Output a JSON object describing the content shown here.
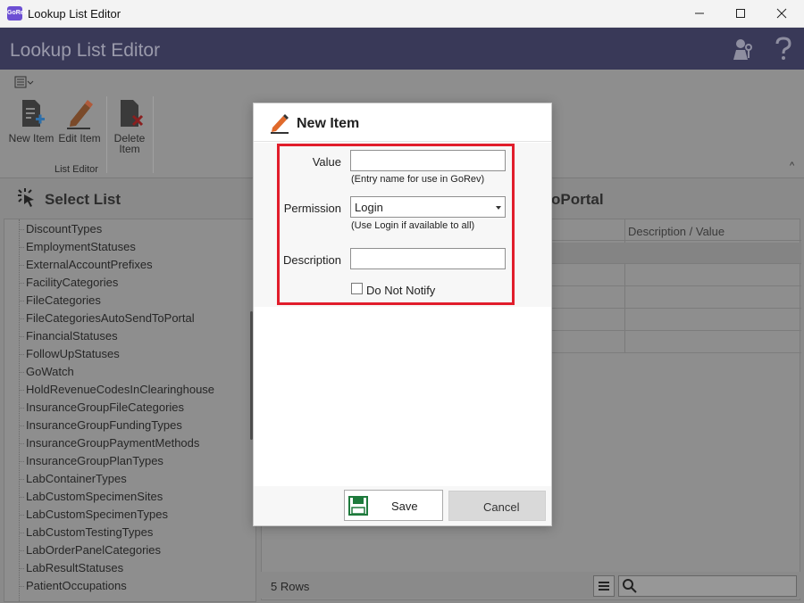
{
  "window": {
    "title": "Lookup List Editor",
    "app_icon_label": "GoRev"
  },
  "header": {
    "title": "Lookup List Editor",
    "icons": [
      "user-keys-icon",
      "help-icon"
    ]
  },
  "ribbon": {
    "buttons": [
      {
        "label": "New Item",
        "icon": "document-plus-icon"
      },
      {
        "label": "Edit Item",
        "icon": "pencil-icon"
      },
      {
        "label": "Delete Item",
        "icon": "document-delete-icon"
      }
    ],
    "group_label": "List Editor"
  },
  "select_list": {
    "title": "Select List",
    "items": [
      "DiscountTypes",
      "EmploymentStatuses",
      "ExternalAccountPrefixes",
      "FacilityCategories",
      "FileCategories",
      "FileCategoriesAutoSendToPortal",
      "FinancialStatuses",
      "FollowUpStatuses",
      "GoWatch",
      "HoldRevenueCodesInClearinghouse",
      "InsuranceGroupFileCategories",
      "InsuranceGroupFundingTypes",
      "InsuranceGroupPaymentMethods",
      "InsuranceGroupPlanTypes",
      "LabContainerTypes",
      "LabCustomSpecimenSites",
      "LabCustomSpecimenTypes",
      "LabCustomTestingTypes",
      "LabOrderPanelCategories",
      "LabResultStatuses",
      "PatientOccupations"
    ]
  },
  "detail": {
    "title_fragment": "oPortal",
    "column_header": "Description / Value",
    "rows_count": "5 Rows"
  },
  "modal": {
    "title": "New Item",
    "value_label": "Value",
    "value_input": "",
    "value_hint": "(Entry name for use in GoRev)",
    "permission_label": "Permission",
    "permission_value": "Login",
    "permission_hint": "(Use Login if available to all)",
    "description_label": "Description",
    "description_input": "",
    "notify_label": "Do Not Notify",
    "notify_checked": false,
    "save_label": "Save",
    "cancel_label": "Cancel"
  },
  "colors": {
    "header_bg": "#393958",
    "highlight_border": "#e11d2b",
    "save_icon": "#1e7a3c"
  }
}
